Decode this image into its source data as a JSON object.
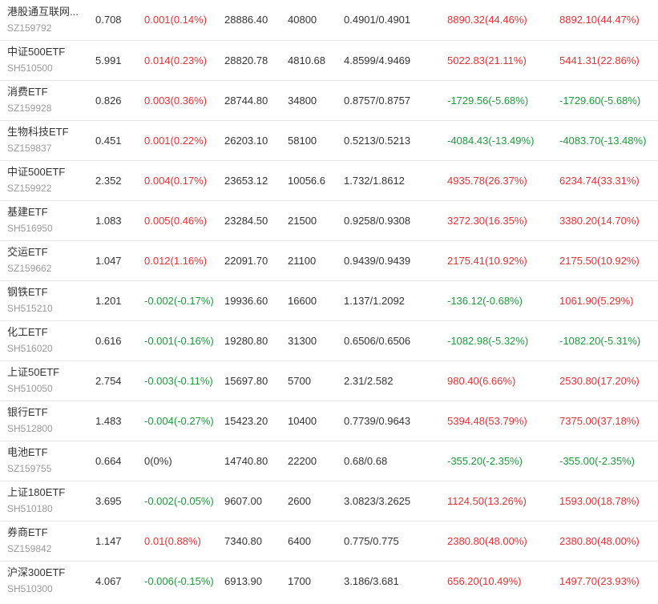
{
  "colors": {
    "up": "#e93030",
    "down": "#1a9c3a",
    "neutral": "#333333",
    "code": "#999999",
    "row_divider": "#e6e6e6"
  },
  "rows": [
    {
      "name": "港股通互联网...",
      "code": "SZ159792",
      "price": "0.708",
      "change": "0.001(0.14%)",
      "change_dir": "up",
      "amount": "28886.40",
      "volume": "40800",
      "cost": "0.4901/0.4901",
      "pnl1": "8890.32(44.46%)",
      "pnl1_dir": "up",
      "pnl2": "8892.10(44.47%)",
      "pnl2_dir": "up"
    },
    {
      "name": "中证500ETF",
      "code": "SH510500",
      "price": "5.991",
      "change": "0.014(0.23%)",
      "change_dir": "up",
      "amount": "28820.78",
      "volume": "4810.68",
      "cost": "4.8599/4.9469",
      "pnl1": "5022.83(21.11%)",
      "pnl1_dir": "up",
      "pnl2": "5441.31(22.86%)",
      "pnl2_dir": "up"
    },
    {
      "name": "消费ETF",
      "code": "SZ159928",
      "price": "0.826",
      "change": "0.003(0.36%)",
      "change_dir": "up",
      "amount": "28744.80",
      "volume": "34800",
      "cost": "0.8757/0.8757",
      "pnl1": "-1729.56(-5.68%)",
      "pnl1_dir": "down",
      "pnl2": "-1729.60(-5.68%)",
      "pnl2_dir": "down"
    },
    {
      "name": "生物科技ETF",
      "code": "SZ159837",
      "price": "0.451",
      "change": "0.001(0.22%)",
      "change_dir": "up",
      "amount": "26203.10",
      "volume": "58100",
      "cost": "0.5213/0.5213",
      "pnl1": "-4084.43(-13.49%)",
      "pnl1_dir": "down",
      "pnl2": "-4083.70(-13.48%)",
      "pnl2_dir": "down"
    },
    {
      "name": "中证500ETF",
      "code": "SZ159922",
      "price": "2.352",
      "change": "0.004(0.17%)",
      "change_dir": "up",
      "amount": "23653.12",
      "volume": "10056.6",
      "cost": "1.732/1.8612",
      "pnl1": "4935.78(26.37%)",
      "pnl1_dir": "up",
      "pnl2": "6234.74(33.31%)",
      "pnl2_dir": "up"
    },
    {
      "name": "基建ETF",
      "code": "SH516950",
      "price": "1.083",
      "change": "0.005(0.46%)",
      "change_dir": "up",
      "amount": "23284.50",
      "volume": "21500",
      "cost": "0.9258/0.9308",
      "pnl1": "3272.30(16.35%)",
      "pnl1_dir": "up",
      "pnl2": "3380.20(14.70%)",
      "pnl2_dir": "up"
    },
    {
      "name": "交运ETF",
      "code": "SZ159662",
      "price": "1.047",
      "change": "0.012(1.16%)",
      "change_dir": "up",
      "amount": "22091.70",
      "volume": "21100",
      "cost": "0.9439/0.9439",
      "pnl1": "2175.41(10.92%)",
      "pnl1_dir": "up",
      "pnl2": "2175.50(10.92%)",
      "pnl2_dir": "up"
    },
    {
      "name": "钢铁ETF",
      "code": "SH515210",
      "price": "1.201",
      "change": "-0.002(-0.17%)",
      "change_dir": "down",
      "amount": "19936.60",
      "volume": "16600",
      "cost": "1.137/1.2092",
      "pnl1": "-136.12(-0.68%)",
      "pnl1_dir": "down",
      "pnl2": "1061.90(5.29%)",
      "pnl2_dir": "up"
    },
    {
      "name": "化工ETF",
      "code": "SH516020",
      "price": "0.616",
      "change": "-0.001(-0.16%)",
      "change_dir": "down",
      "amount": "19280.80",
      "volume": "31300",
      "cost": "0.6506/0.6506",
      "pnl1": "-1082.98(-5.32%)",
      "pnl1_dir": "down",
      "pnl2": "-1082.20(-5.31%)",
      "pnl2_dir": "down"
    },
    {
      "name": "上证50ETF",
      "code": "SH510050",
      "price": "2.754",
      "change": "-0.003(-0.11%)",
      "change_dir": "down",
      "amount": "15697.80",
      "volume": "5700",
      "cost": "2.31/2.582",
      "pnl1": "980.40(6.66%)",
      "pnl1_dir": "up",
      "pnl2": "2530.80(17.20%)",
      "pnl2_dir": "up"
    },
    {
      "name": "银行ETF",
      "code": "SH512800",
      "price": "1.483",
      "change": "-0.004(-0.27%)",
      "change_dir": "down",
      "amount": "15423.20",
      "volume": "10400",
      "cost": "0.7739/0.9643",
      "pnl1": "5394.48(53.79%)",
      "pnl1_dir": "up",
      "pnl2": "7375.00(37.18%)",
      "pnl2_dir": "up"
    },
    {
      "name": "电池ETF",
      "code": "SZ159755",
      "price": "0.664",
      "change": "0(0%)",
      "change_dir": "neutral",
      "amount": "14740.80",
      "volume": "22200",
      "cost": "0.68/0.68",
      "pnl1": "-355.20(-2.35%)",
      "pnl1_dir": "down",
      "pnl2": "-355.00(-2.35%)",
      "pnl2_dir": "down"
    },
    {
      "name": "上证180ETF",
      "code": "SH510180",
      "price": "3.695",
      "change": "-0.002(-0.05%)",
      "change_dir": "down",
      "amount": "9607.00",
      "volume": "2600",
      "cost": "3.0823/3.2625",
      "pnl1": "1124.50(13.26%)",
      "pnl1_dir": "up",
      "pnl2": "1593.00(18.78%)",
      "pnl2_dir": "up"
    },
    {
      "name": "券商ETF",
      "code": "SZ159842",
      "price": "1.147",
      "change": "0.01(0.88%)",
      "change_dir": "up",
      "amount": "7340.80",
      "volume": "6400",
      "cost": "0.775/0.775",
      "pnl1": "2380.80(48.00%)",
      "pnl1_dir": "up",
      "pnl2": "2380.80(48.00%)",
      "pnl2_dir": "up"
    },
    {
      "name": "沪深300ETF",
      "code": "SH510300",
      "price": "4.067",
      "change": "-0.006(-0.15%)",
      "change_dir": "down",
      "amount": "6913.90",
      "volume": "1700",
      "cost": "3.186/3.681",
      "pnl1": "656.20(10.49%)",
      "pnl1_dir": "up",
      "pnl2": "1497.70(23.93%)",
      "pnl2_dir": "up"
    }
  ]
}
